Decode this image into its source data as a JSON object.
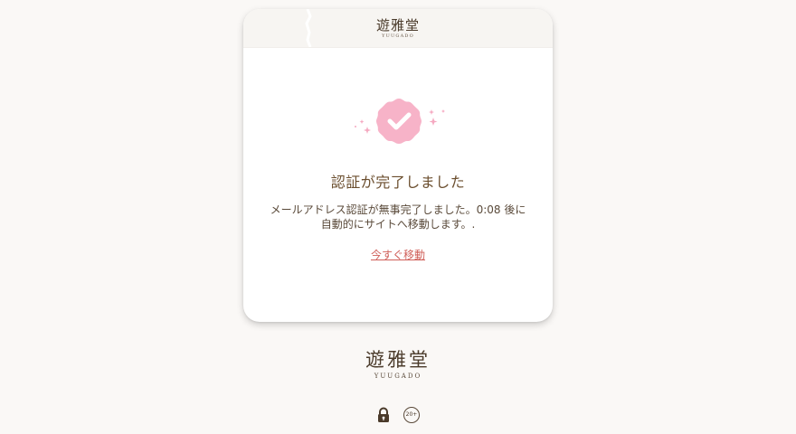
{
  "header": {
    "brand_kanji": "遊雅堂",
    "brand_roman": "YUUGADO"
  },
  "card": {
    "badge_icon": "verified-check-badge-icon",
    "badge_color": "#f7b3c8",
    "sparkle_color": "#f5a8c0",
    "title": "認証が完了しました",
    "message_line1": "メールアドレス認証が無事完了しました。0:08 後に",
    "message_line2": "自動的にサイトへ移動します。.",
    "link_label": "今すぐ移動",
    "link_color": "#d0605a"
  },
  "footer": {
    "brand_kanji": "遊雅堂",
    "brand_roman": "YUUGADO",
    "lock_icon": "lock-icon",
    "age_badge": "20+"
  }
}
